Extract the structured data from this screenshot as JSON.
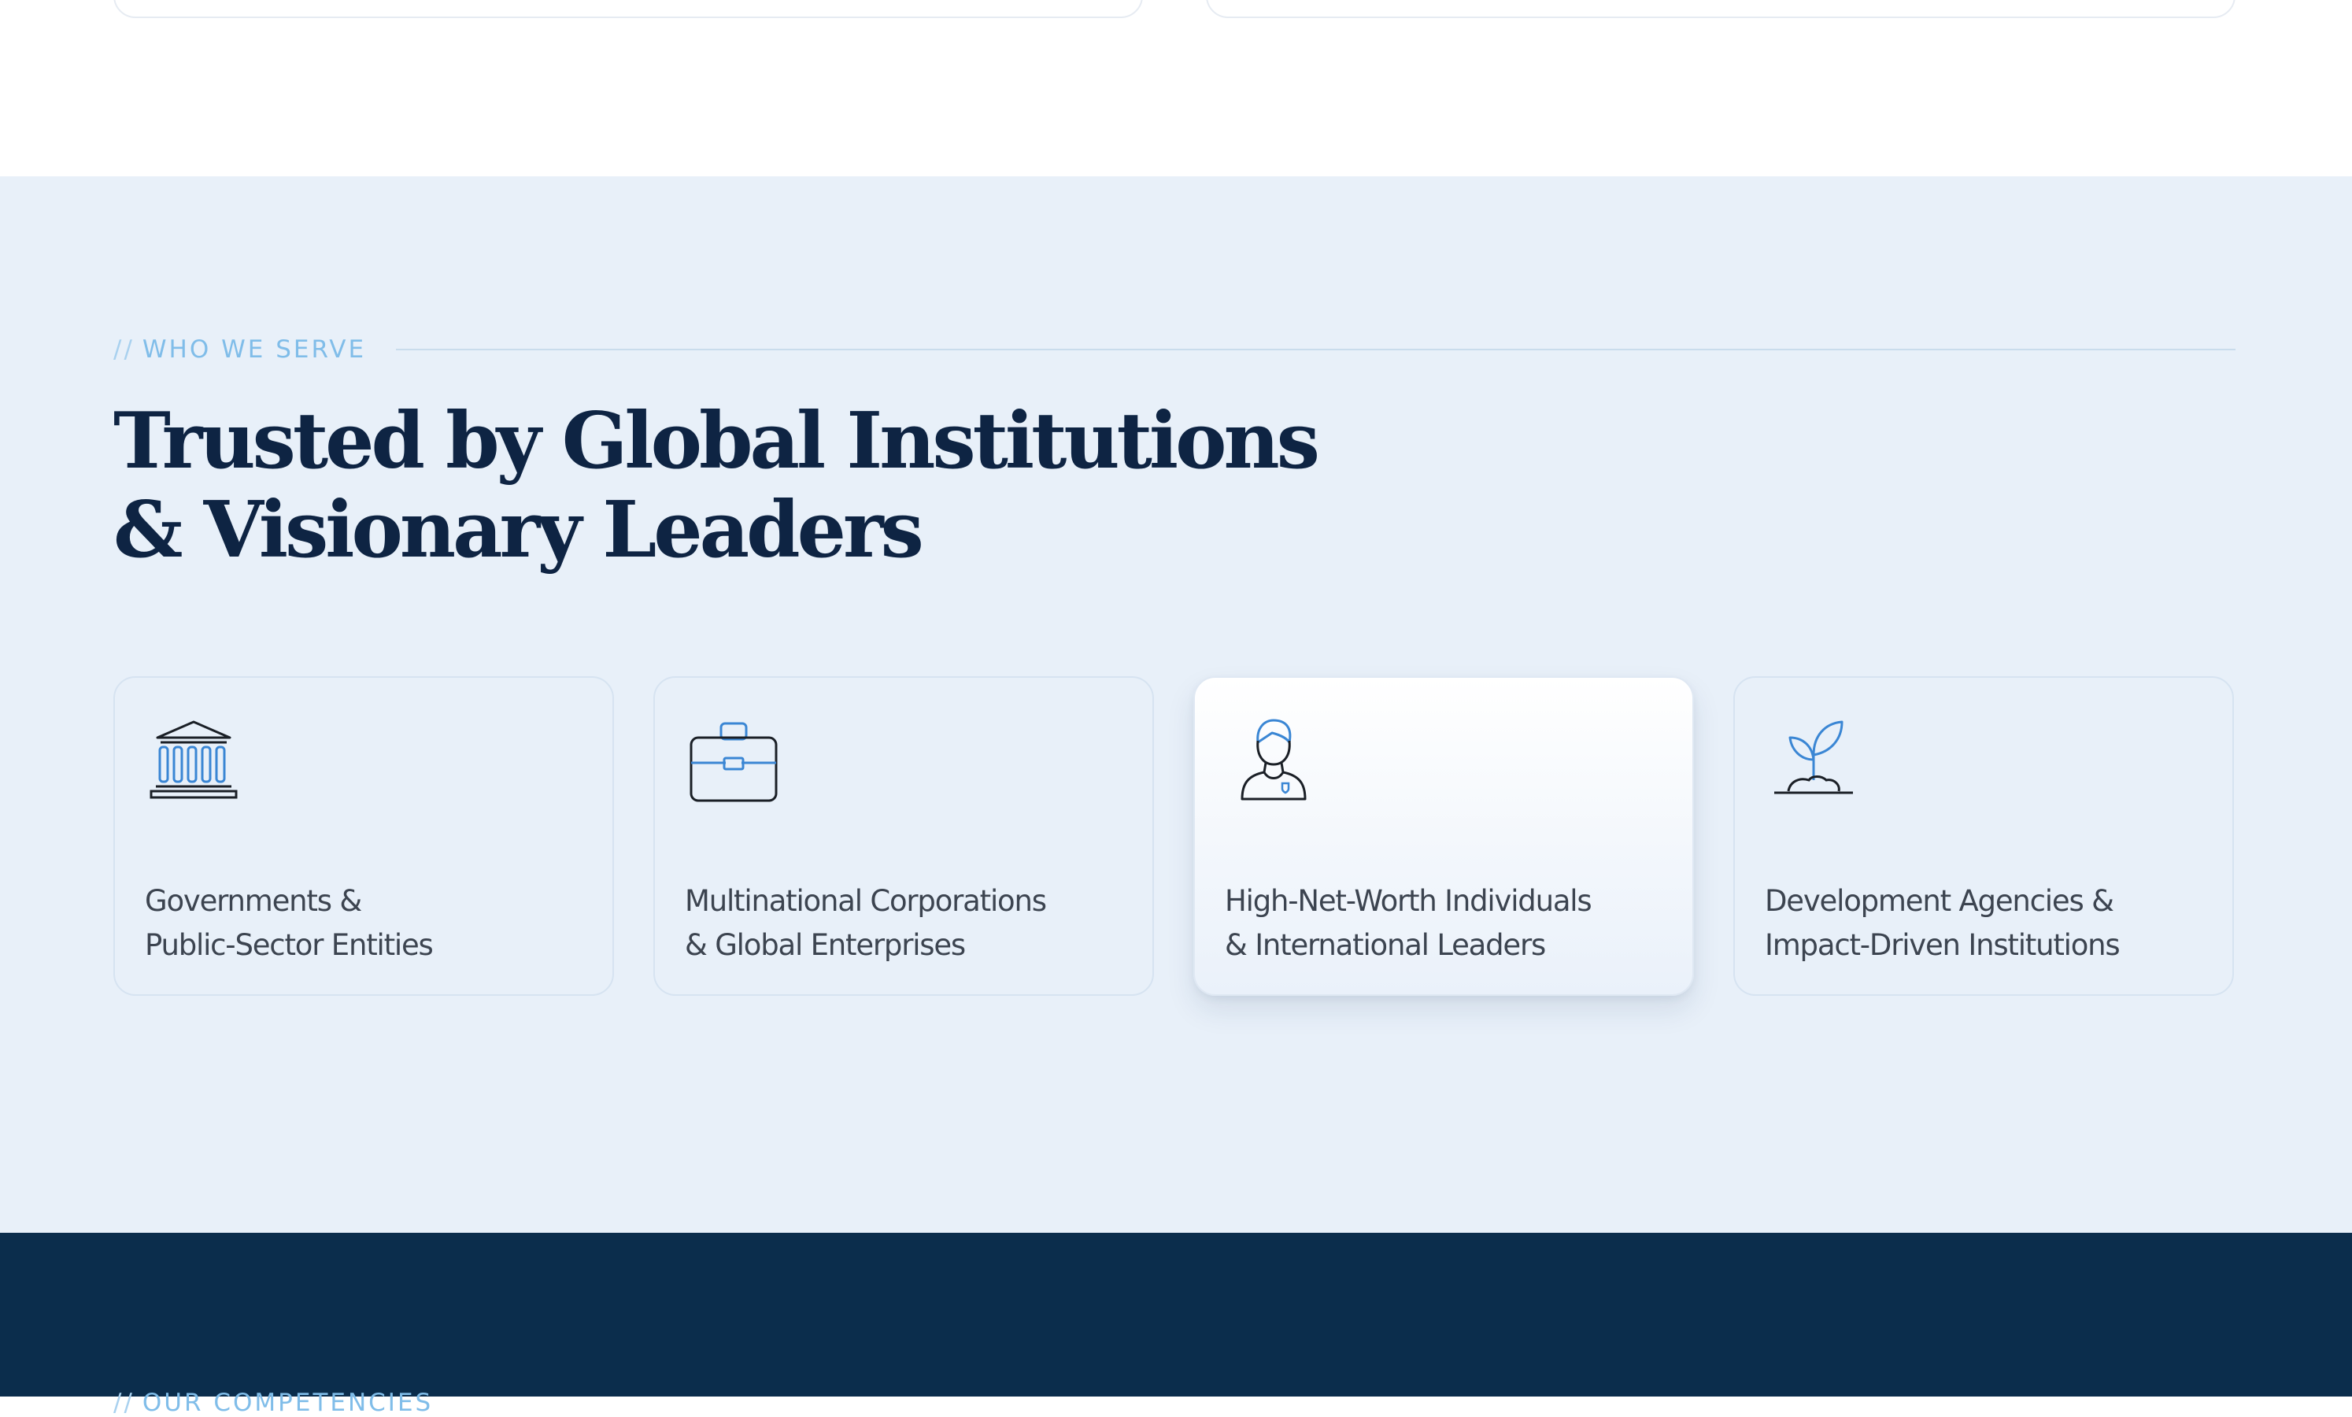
{
  "serve": {
    "eyebrow_slashes": "//",
    "eyebrow": "WHO WE SERVE",
    "headline_line1": "Trusted by Global Institutions",
    "headline_line2": "& Visionary Leaders",
    "cards": [
      {
        "icon": "government-building-icon",
        "line1": "Governments &",
        "line2": "Public-Sector Entities",
        "active": false
      },
      {
        "icon": "briefcase-icon",
        "line1": "Multinational Corporations",
        "line2": "& Global Enterprises",
        "active": false
      },
      {
        "icon": "person-icon",
        "line1": "High-Net-Worth Individuals",
        "line2": "& International Leaders",
        "active": true
      },
      {
        "icon": "sprout-icon",
        "line1": "Development Agencies &",
        "line2": "Impact-Driven Institutions",
        "active": false
      }
    ]
  },
  "next_section": {
    "eyebrow_slashes": "//",
    "eyebrow": "OUR COMPETENCIES"
  },
  "colors": {
    "section_bg": "#e8f0f9",
    "dark_bg": "#0b2d4c",
    "heading": "#0e2443",
    "accent": "#80bde9",
    "icon_blue": "#3a86d4",
    "icon_dark": "#1a1f26"
  }
}
